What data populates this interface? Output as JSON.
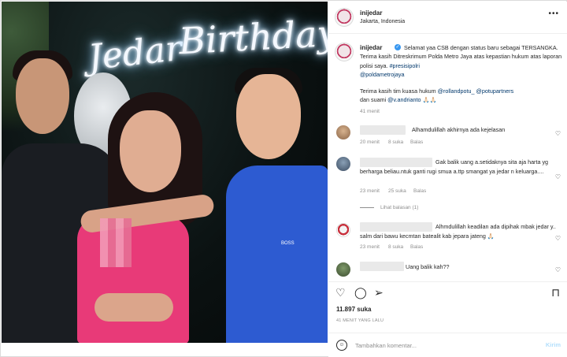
{
  "photo": {
    "neon_line1": "Jedar",
    "neon_line2": "Birthday",
    "shirt_text": "BOSS"
  },
  "header": {
    "username": "inijedar",
    "location": "Jakarta, Indonesia",
    "more": "•••"
  },
  "caption": {
    "username": "inijedar",
    "text_a": "Selamat yaa CSB dengan status baru sebagai TERSANGKA. Terima kasih Ditreskrimum Polda Metro Jaya atas kepastian hukum atas laporan polisi saya.",
    "tag1": "#presisipolri",
    "tag2": "@poldametrojaya",
    "text_b": "Terima kasih tim kuasa hukum",
    "mention1": "@rollandpotu_",
    "mention2": "@potupartners",
    "text_c": "dan suami",
    "mention3": "@v.andrianto",
    "emoji": "🙏🏻🙏🏻",
    "time": "41 menit"
  },
  "comments": [
    {
      "text": "Alhamdulillah akhirnya ada kejelasan",
      "time": "20 menit",
      "likes": "8 suka",
      "reply": "Balas"
    },
    {
      "text": "Gak balik uang a.setidaknya sita aja harta yg berharga beliau.ntuk ganti rugi smua a.ttp smangat ya jedar n keluarga....",
      "time": "23 menit",
      "likes": "25 suka",
      "reply": "Balas"
    },
    {
      "text": "Alhmdulillah keadilan ada dipihak mbak jedar y.. salm dari bawu kecmtan batealit kab jepara jateng 🙏🏻",
      "time": "23 menit",
      "likes": "8 suka",
      "reply": "Balas"
    },
    {
      "text": "Uang balik kah??",
      "time": "",
      "likes": "",
      "reply": ""
    }
  ],
  "view_replies": "Lihat balasan (1)",
  "likes": {
    "count": "11.897",
    "label": "suka"
  },
  "time_ago": "41 MENIT YANG LALU",
  "composer": {
    "placeholder": "Tambahkan komentar...",
    "post": "Kirim"
  },
  "icons": [
    "heart-icon",
    "comment-icon",
    "share-icon",
    "bookmark-icon",
    "emoji-icon",
    "more-icon",
    "verified-icon"
  ],
  "colors": {
    "link": "#00376b",
    "verified": "#3897f0",
    "post_button": "#b2dffc",
    "dress": "#e83a78",
    "shirt": "#2d5bd1"
  }
}
